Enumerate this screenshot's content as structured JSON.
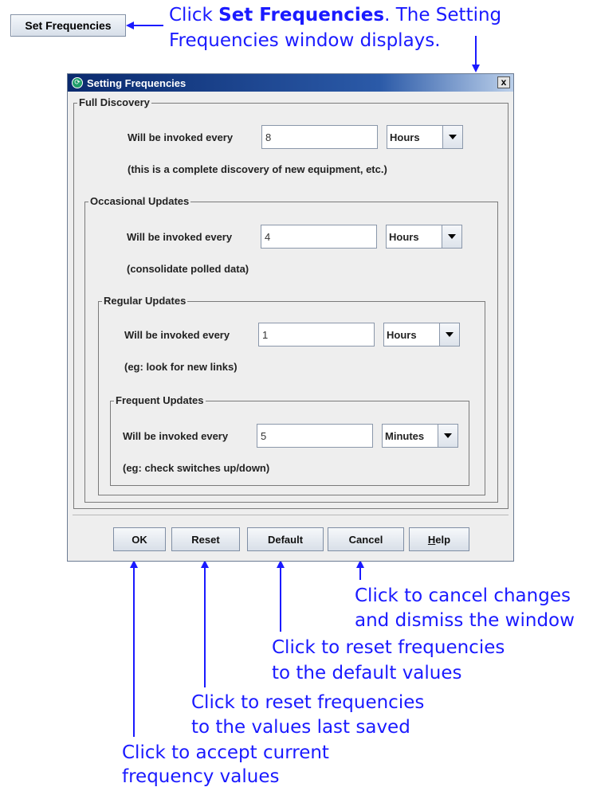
{
  "annotations": {
    "top_prefix": "Click",
    "top_bold": "Set Frequencies",
    "top_suffix": ". The Setting",
    "top_line2": "Frequencies window displays.",
    "cancel_line1": "Click to cancel  changes",
    "cancel_line2": "and dismiss the window",
    "default_line1": "Click to reset frequencies",
    "default_line2": "to the default values",
    "reset_line1": "Click to reset frequencies",
    "reset_line2": "to the values last saved",
    "ok_line1": "Click to accept current",
    "ok_line2": "frequency values"
  },
  "set_frequencies_button": "Set Frequencies",
  "dialog": {
    "title": "Setting Frequencies",
    "close": "x",
    "groups": {
      "full": {
        "legend": "Full Discovery",
        "label": "Will be invoked every",
        "value": "8",
        "unit": "Hours",
        "note": "(this is a complete discovery of new equipment, etc.)"
      },
      "occasional": {
        "legend": "Occasional Updates",
        "label": "Will be invoked every",
        "value": "4",
        "unit": "Hours",
        "note": "(consolidate polled data)"
      },
      "regular": {
        "legend": "Regular Updates",
        "label": "Will be invoked every",
        "value": "1",
        "unit": "Hours",
        "note": "(eg: look for new links)"
      },
      "frequent": {
        "legend": "Frequent Updates",
        "label": "Will be invoked every",
        "value": "5",
        "unit": "Minutes",
        "note": "(eg: check switches up/down)"
      }
    },
    "buttons": {
      "ok": "OK",
      "reset": "Reset",
      "default": "Default",
      "cancel": "Cancel",
      "help_mnemonic": "H",
      "help_rest": "elp"
    }
  },
  "colors": {
    "annotation": "#1a1aff",
    "titlebar": "#0a2a6e",
    "dialog_bg": "#eeeeee"
  }
}
